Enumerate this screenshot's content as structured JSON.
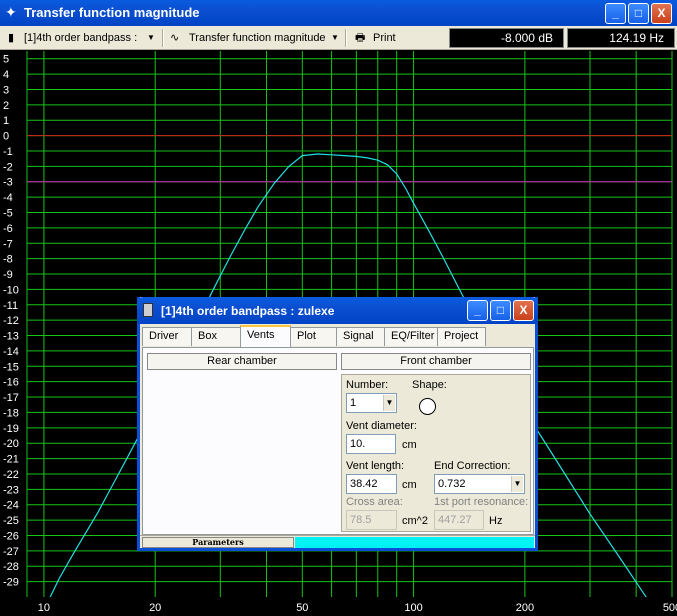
{
  "window": {
    "title": "Transfer function magnitude",
    "buttons": {
      "minimize": "_",
      "maximize": "□",
      "close": "X"
    }
  },
  "toolbar": {
    "project_select": "[1]4th order bandpass :",
    "view_select": "Transfer function magnitude",
    "print_label": "Print",
    "readout_level": "-8.000 dB",
    "readout_freq": "124.19 Hz"
  },
  "chart_data": {
    "type": "line",
    "xscale": "log",
    "xlim": [
      9,
      500
    ],
    "ylim": [
      -30,
      5.5
    ],
    "x_ticks": [
      10,
      20,
      50,
      100,
      200,
      500
    ],
    "y_ticks": [
      5,
      4,
      3,
      2,
      1,
      0,
      -1,
      -2,
      -3,
      -4,
      -5,
      -6,
      -7,
      -8,
      -9,
      -10,
      -11,
      -12,
      -13,
      -14,
      -15,
      -16,
      -17,
      -18,
      -19,
      -20,
      -21,
      -22,
      -23,
      -24,
      -25,
      -26,
      -27,
      -28,
      -29
    ],
    "reference_lines": [
      {
        "y": 0,
        "color": "#d41c1c"
      },
      {
        "y": -3,
        "color": "#d41cc0"
      }
    ],
    "grid": true,
    "series": [
      {
        "color": "#21e0e0",
        "x": [
          10.3,
          11,
          12,
          14,
          16,
          18,
          20,
          23,
          26,
          29,
          32,
          35,
          38,
          42,
          46,
          50,
          55,
          60,
          65,
          70,
          75,
          80,
          85,
          90,
          95,
          100,
          110,
          120,
          135,
          150,
          170,
          200,
          240,
          300,
          360,
          420,
          470
        ],
        "y": [
          -30.2,
          -28.8,
          -27.2,
          -24.5,
          -21.9,
          -19.6,
          -17.5,
          -14.7,
          -12.1,
          -9.8,
          -7.8,
          -6.1,
          -4.6,
          -3.1,
          -2.0,
          -1.3,
          -1.2,
          -1.25,
          -1.3,
          -1.35,
          -1.45,
          -1.6,
          -1.9,
          -2.5,
          -3.4,
          -4.4,
          -6.2,
          -7.9,
          -10.3,
          -12.4,
          -14.9,
          -17.9,
          -20.9,
          -24.6,
          -27.4,
          -29.8,
          -31.5
        ]
      }
    ]
  },
  "dialog": {
    "title": "[1]4th order bandpass : zulexe",
    "tabs": [
      "Driver",
      "Box",
      "Vents",
      "Plot",
      "Signal",
      "EQ/Filter",
      "Project"
    ],
    "active_tab": "Vents",
    "rear_chamber_label": "Rear chamber",
    "front_chamber_label": "Front chamber",
    "number_label": "Number:",
    "number_value": "1",
    "shape_label": "Shape:",
    "vent_diameter_label": "Vent diameter:",
    "vent_diameter_value": "10.",
    "vent_diameter_unit": "cm",
    "vent_length_label": "Vent length:",
    "vent_length_value": "38.42",
    "vent_length_unit": "cm",
    "end_correction_label": "End Correction:",
    "end_correction_value": "0.732",
    "cross_area_label": "Cross area:",
    "cross_area_value": "78.5",
    "cross_area_unit": "cm^2",
    "port_resonance_label": "1st port resonance:",
    "port_resonance_value": "447.27",
    "port_resonance_unit": "Hz",
    "status_label": "Parameters"
  }
}
